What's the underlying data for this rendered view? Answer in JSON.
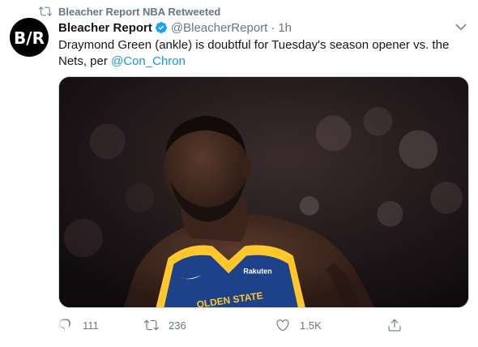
{
  "retweet_context": {
    "label": "Bleacher Report NBA Retweeted",
    "icon": "retweet-icon"
  },
  "author": {
    "name": "Bleacher Report",
    "handle": "@BleacherReport",
    "separator": "·",
    "time": "1h",
    "avatar_text": "B/R",
    "verified_color": "#1da1f2"
  },
  "tweet": {
    "text_before": "Draymond Green (ankle) is doubtful for Tuesday's season opener vs. the Nets, per ",
    "mention": "@Con_Chron"
  },
  "media": {
    "jersey_brand": "Rakuten",
    "jersey_text": "OLDEN STATE"
  },
  "actions": {
    "reply_count": "111",
    "retweet_count": "236",
    "like_count": "1.5K"
  },
  "colors": {
    "link": "#1b95e0",
    "secondary_text": "#657786",
    "jersey_blue": "#1d428a",
    "jersey_gold": "#ffc72c"
  }
}
